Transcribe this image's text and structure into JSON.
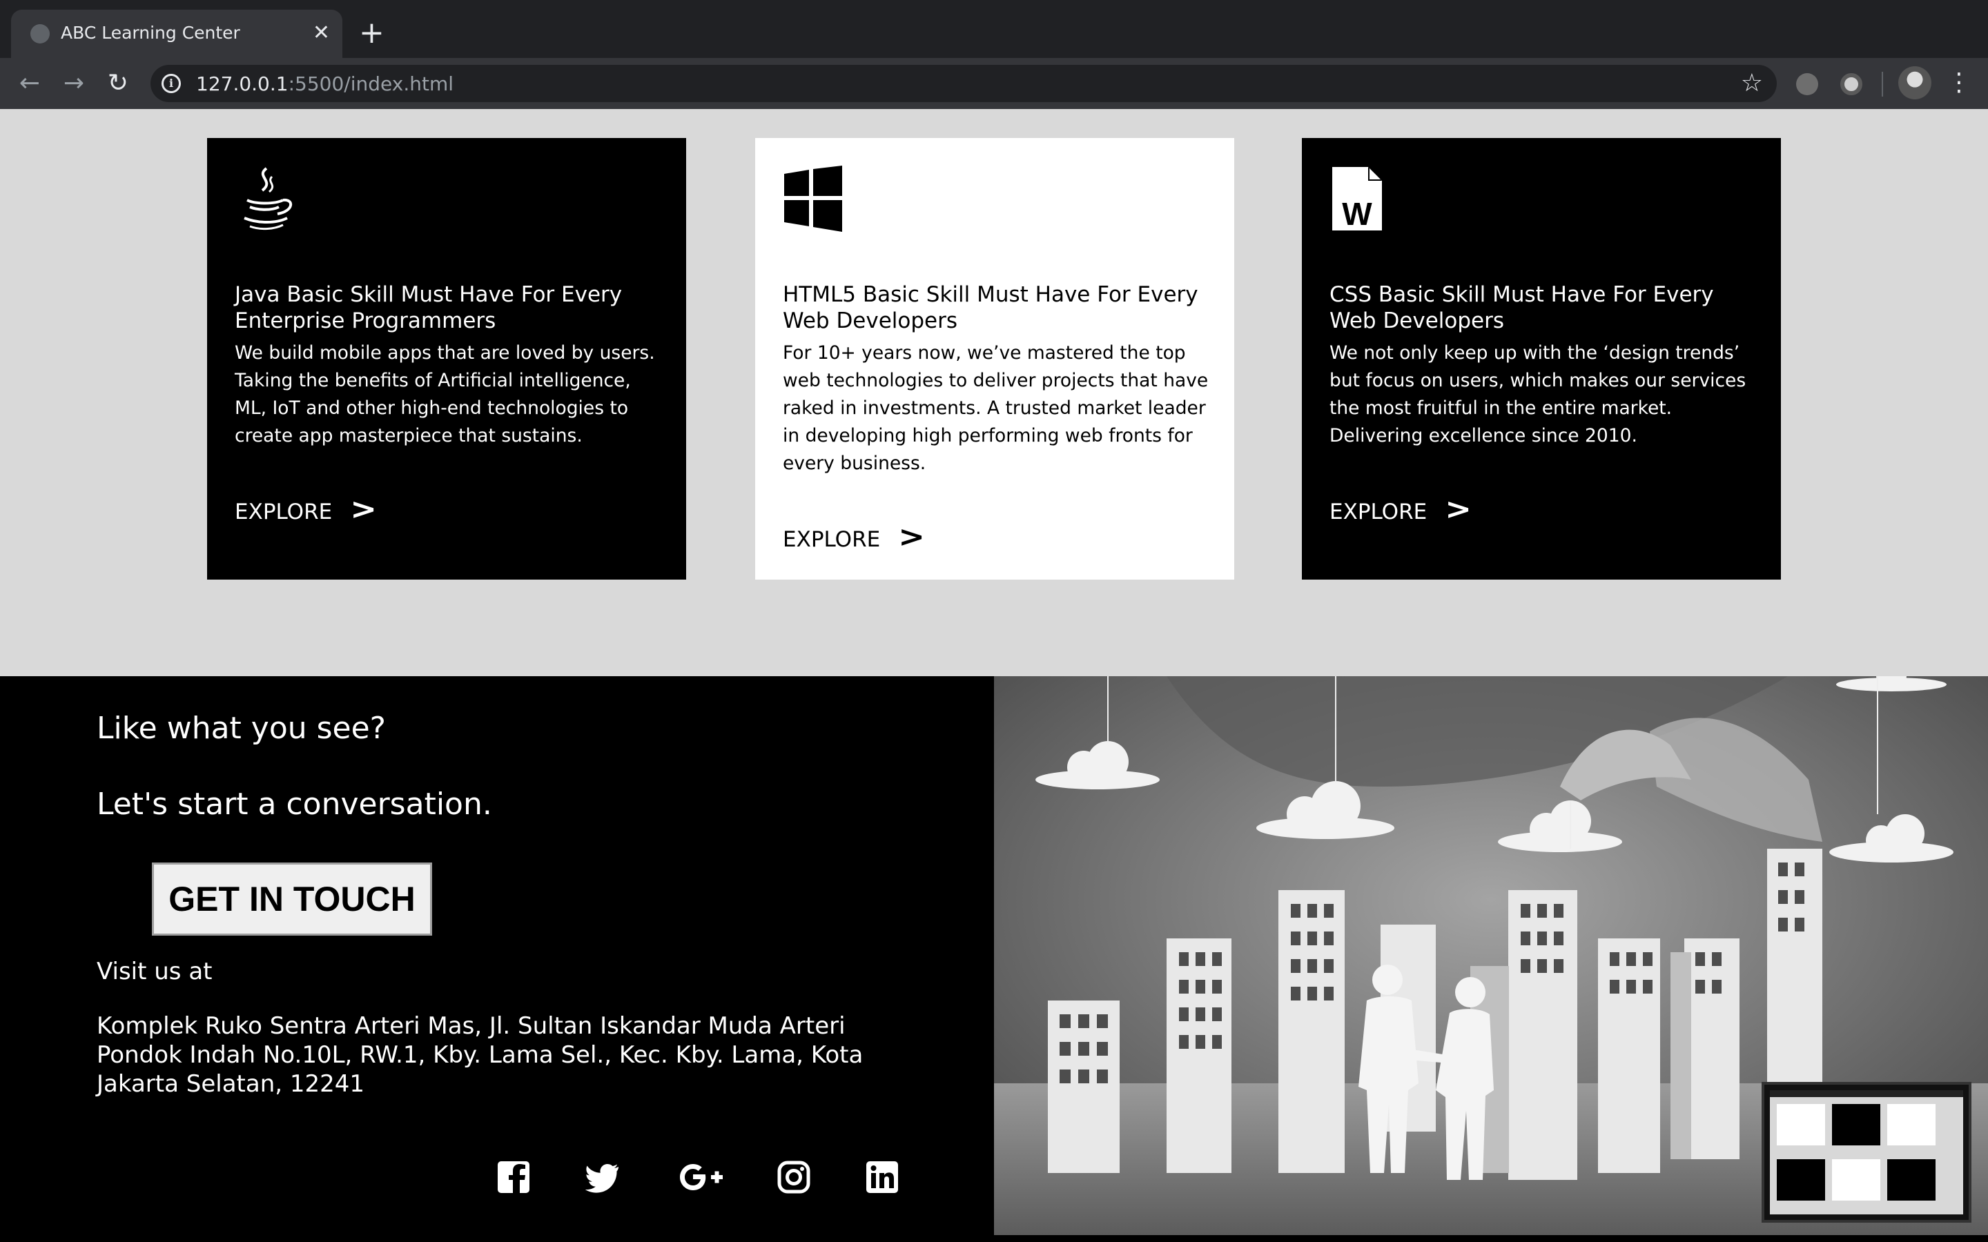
{
  "browser": {
    "tab_title": "ABC Learning Center",
    "tab_close": "✕",
    "new_tab": "+",
    "url_host": "127.0.0.1",
    "url_rest": ":5500/index.html"
  },
  "cards": [
    {
      "icon": "java-icon",
      "title": "Java Basic Skill Must Have For Every Enterprise Programmers",
      "text": "We build mobile apps that are loved by users. Taking the benefits of Artificial intelligence, ML, IoT and other high-end technologies to create app masterpiece that sustains.",
      "link": "EXPLORE",
      "arrow": ">"
    },
    {
      "icon": "windows-icon",
      "title": "HTML5 Basic Skill Must Have For Every Web Developers",
      "text": "For 10+ years now, we’ve mastered the top web technologies to deliver projects that have raked in investments. A trusted market leader in developing high performing web fronts for every business.",
      "link": "EXPLORE",
      "arrow": ">"
    },
    {
      "icon": "word-document-icon",
      "icon_letter": "W",
      "title": "CSS Basic Skill Must Have For Every Web Developers",
      "text": "We not only keep up with the ‘design trends’ but focus on users, which makes our services the most fruitful in the entire market. Delivering excellence since 2010.",
      "link": "EXPLORE",
      "arrow": ">"
    }
  ],
  "contact": {
    "heading1": "Like what you see?",
    "heading2": "Let's start a conversation.",
    "cta": "GET IN TOUCH",
    "visit_label": "Visit us at",
    "address": "Komplek Ruko Sentra Arteri Mas, Jl. Sultan Iskandar Muda Arteri Pondok Indah No.10L, RW.1, Kby. Lama Sel., Kec. Kby. Lama, Kota Jakarta Selatan, 12241"
  },
  "social": [
    "facebook-icon",
    "twitter-icon",
    "google-plus-icon",
    "instagram-icon",
    "linkedin-icon"
  ],
  "colors": {
    "chrome_dark": "#202124",
    "chrome_toolbar": "#35363a",
    "cards_bg": "#d9d9d9",
    "card_dark": "#000000",
    "card_light": "#ffffff"
  }
}
